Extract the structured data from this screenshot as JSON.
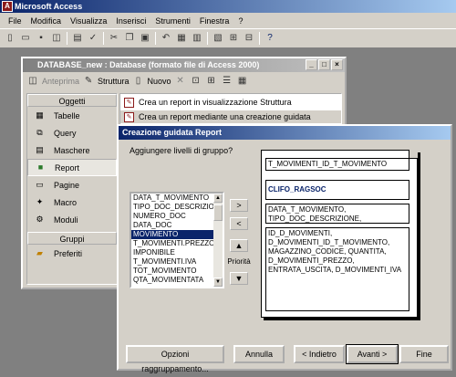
{
  "app": {
    "title": "Microsoft Access"
  },
  "menu": [
    "File",
    "Modifica",
    "Visualizza",
    "Inserisci",
    "Strumenti",
    "Finestra",
    "?"
  ],
  "toolbar_icons": [
    "new-icon",
    "open-icon",
    "save-icon",
    "print-preview-icon",
    "print-icon",
    "spell-check-icon",
    "cut-icon",
    "copy-icon",
    "paste-icon",
    "undo-icon",
    "analyze-icon",
    "office-links-icon",
    "properties-icon",
    "relationships-icon",
    "new-object-icon",
    "help-icon"
  ],
  "db_window": {
    "title": "DATABASE_new : Database (formato file di Access 2000)",
    "toolbar": {
      "preview": "Anteprima",
      "design": "Struttura",
      "new": "Nuovo"
    },
    "objects_header": "Oggetti",
    "objects": [
      "Tabelle",
      "Query",
      "Maschere",
      "Report",
      "Pagine",
      "Macro",
      "Moduli"
    ],
    "active_object": "Report",
    "groups_header": "Gruppi",
    "groups": [
      "Preferiti"
    ],
    "items": [
      "Crea un report in visualizzazione Struttura",
      "Crea un report mediante una creazione guidata"
    ]
  },
  "wizard": {
    "title": "Creazione guidata Report",
    "prompt": "Aggiungere livelli di gruppo?",
    "fields": [
      "DATA_T_MOVIMENTO",
      "TIPO_DOC_DESCRIZIONE",
      "NUMERO_DOC",
      "DATA_DOC",
      "MOVIMENTO",
      "T_MOVIMENTI.PREZZO",
      "IMPONIBILE",
      "T_MOVIMENTI.IVA",
      "TOT_MOVIMENTO",
      "QTA_MOVIMENTATA"
    ],
    "selected_field": "MOVIMENTO",
    "move_buttons": {
      "add": ">",
      "remove": "<",
      "up": "▲",
      "down": "▼"
    },
    "priority_label": "Priorità",
    "preview": {
      "group1": "T_MOVIMENTI_ID_T_MOVIMENTO",
      "group2": "CLIFO_RAGSOC",
      "group3": "DATA_T_MOVIMENTO, TIPO_DOC_DESCRIZIONE,",
      "detail": "ID_D_MOVIMENTI, D_MOVIMENTI_ID_T_MOVIMENTO, MAGAZZINO_CODICE, QUANTITA, D_MOVIMENTI_PREZZO, ENTRATA_USCITA, D_MOVIMENTI_IVA"
    },
    "buttons": {
      "group_options": "Opzioni raggruppamento...",
      "cancel": "Annulla",
      "back": "< Indietro",
      "next": "Avanti >",
      "finish": "Fine"
    }
  }
}
